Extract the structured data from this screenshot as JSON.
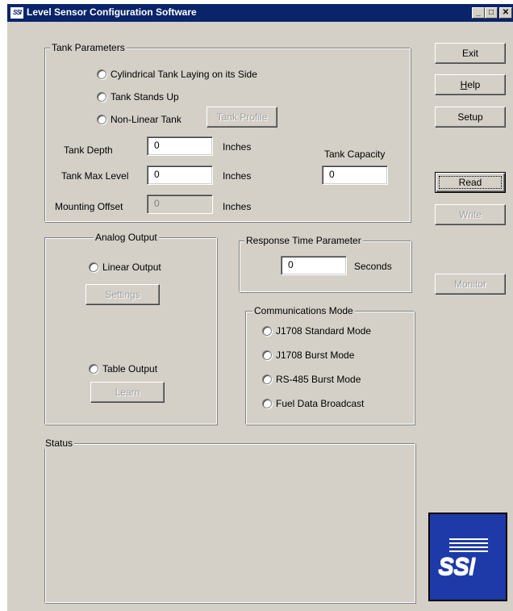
{
  "window": {
    "title": "Level Sensor Configuration Software",
    "app_icon_text": "SSI",
    "controls": {
      "minimize": "_",
      "maximize": "□",
      "close": "✕"
    }
  },
  "buttons": {
    "exit": "Exit",
    "help_prefix": "H",
    "help_rest": "elp",
    "setup": "Setup",
    "read": "Read",
    "write": "Write",
    "monitor": "Monitor",
    "tank_profile": "Tank Profile",
    "settings": "Settings",
    "learn": "Learn"
  },
  "tank_parameters": {
    "title": "Tank Parameters",
    "options": [
      "Cylindrical Tank Laying on its Side",
      "Tank Stands Up",
      "Non-Linear Tank"
    ],
    "fields": {
      "depth_label": "Tank Depth",
      "depth_value": "0",
      "depth_unit": "Inches",
      "max_level_label": "Tank Max Level",
      "max_level_value": "0",
      "max_level_unit": "Inches",
      "offset_label": "Mounting Offset",
      "offset_value": "0",
      "offset_unit": "Inches",
      "capacity_label": "Tank Capacity",
      "capacity_value": "0"
    }
  },
  "analog_output": {
    "title": "Analog Output",
    "linear": "Linear Output",
    "table": "Table Output"
  },
  "response_time": {
    "title": "Response Time Parameter",
    "value": "0",
    "unit": "Seconds"
  },
  "communications": {
    "title": "Communications Mode",
    "modes": [
      "J1708 Standard Mode",
      "J1708 Burst Mode",
      "RS-485 Burst Mode",
      "Fuel Data Broadcast"
    ]
  },
  "status": {
    "title": "Status"
  },
  "logo": {
    "text": "SSI",
    "color": "#1d3aa8"
  }
}
